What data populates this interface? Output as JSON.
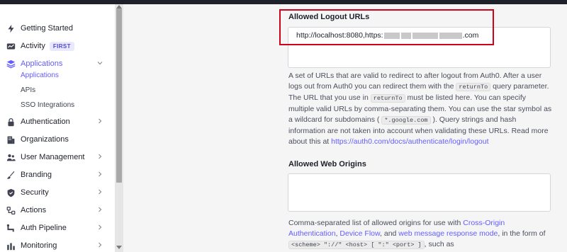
{
  "sidebar": {
    "items": [
      {
        "label": "Getting Started",
        "icon": "bolt-icon"
      },
      {
        "label": "Activity",
        "icon": "chart-icon",
        "badge": "FIRST"
      },
      {
        "label": "Applications",
        "icon": "layers-icon",
        "active": true
      },
      {
        "label": "Authentication",
        "icon": "lock-icon"
      },
      {
        "label": "Organizations",
        "icon": "building-icon"
      },
      {
        "label": "User Management",
        "icon": "users-icon"
      },
      {
        "label": "Branding",
        "icon": "brush-icon"
      },
      {
        "label": "Security",
        "icon": "shield-icon"
      },
      {
        "label": "Actions",
        "icon": "actions-icon"
      },
      {
        "label": "Auth Pipeline",
        "icon": "pipeline-icon"
      },
      {
        "label": "Monitoring",
        "icon": "monitor-icon"
      }
    ],
    "subitems": [
      {
        "label": "Applications",
        "active": true
      },
      {
        "label": "APIs"
      },
      {
        "label": "SSO Integrations"
      }
    ]
  },
  "logout": {
    "label": "Allowed Logout URLs",
    "value_start": "http://localhost:8080,https:",
    "value_end": ".com",
    "help_1": "A set of URLs that are valid to redirect to after logout from Auth0. After a user logs out from Auth0 you can redirect them with the ",
    "code_returnTo": "returnTo",
    "help_2": " query parameter. The URL that you use in ",
    "help_3": " must be listed here. You can specify multiple valid URLs by comma-separating them. You can use the star symbol as a wildcard for subdomains ( ",
    "code_wildcard": "*.google.com",
    "help_4": " ). Query strings and hash information are not taken into account when validating these URLs. Read more about this at ",
    "help_link": "https://auth0.com/docs/authenticate/login/logout"
  },
  "web_origins": {
    "label": "Allowed Web Origins",
    "help_1": "Comma-separated list of allowed origins for use with ",
    "link_cors": "Cross-Origin Authentication",
    "sep_1": ", ",
    "link_device": "Device Flow",
    "sep_2": ", and ",
    "link_wmrm": "web message response mode",
    "help_2": ", in the form of ",
    "code_scheme": "<scheme> \"://\" <host> [ \":\" <port> ]",
    "help_3": ", such as"
  },
  "colors": {
    "accent": "#635dff",
    "highlight": "#d0021b"
  }
}
